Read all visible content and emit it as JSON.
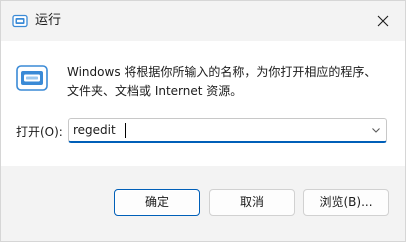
{
  "window": {
    "title": "运行",
    "title_icon": "run-app-icon",
    "close_icon": "close-icon"
  },
  "content": {
    "description_line1": "Windows 将根据你所输入的名称，为你打开相应的程序、",
    "description_line2": "文件夹、文档或 Internet 资源。",
    "run_icon": "run-app-icon",
    "open_label": "打开(O):",
    "open_value": "regedit",
    "dropdown_icon": "chevron-down-icon"
  },
  "buttons": {
    "ok": "确定",
    "cancel": "取消",
    "browse": "浏览(B)..."
  },
  "colors": {
    "accent": "#005fb8",
    "icon_blue": "#3a8ad6"
  }
}
